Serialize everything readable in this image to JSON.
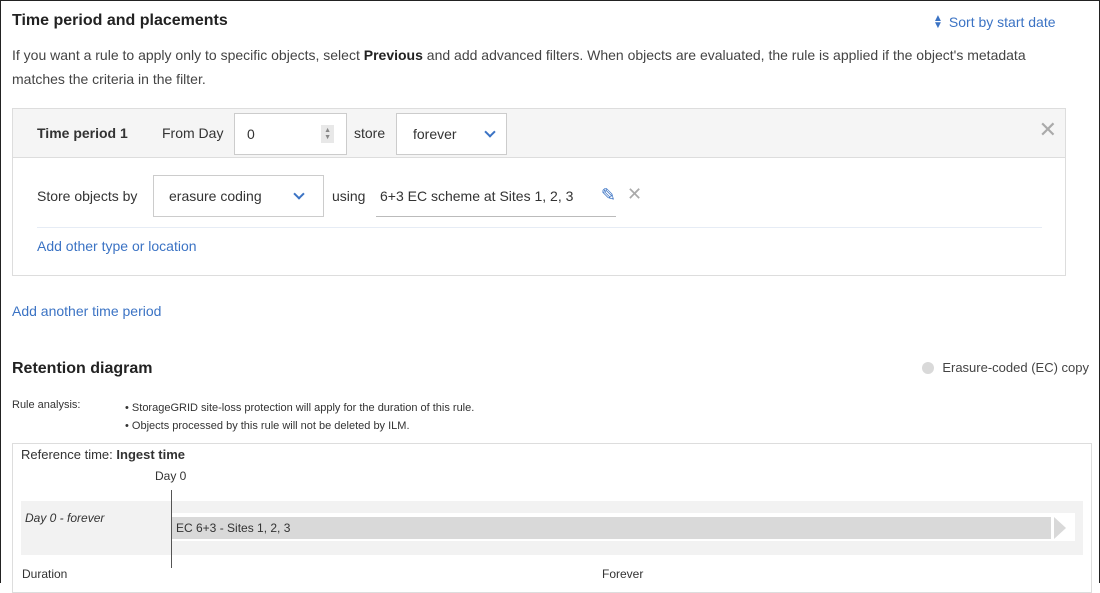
{
  "section": {
    "title": "Time period and placements",
    "sort_label": "Sort by start date",
    "desc_pre": "If you want a rule to apply only to specific objects, select ",
    "desc_bold": "Previous",
    "desc_post": " and add advanced filters. When objects are evaluated, the rule is applied if the object's metadata matches the criteria in the filter."
  },
  "period": {
    "title": "Time period 1",
    "from_label": "From Day",
    "from_value": "0",
    "store_label": "store",
    "store_value": "forever",
    "store_by_label": "Store objects by",
    "store_by_value": "erasure coding",
    "using_label": "using",
    "scheme_value": "6+3 EC scheme at Sites 1, 2, 3",
    "add_other": "Add other type or location"
  },
  "add_period": "Add another time period",
  "diagram": {
    "title": "Retention diagram",
    "legend": "Erasure-coded (EC) copy",
    "legend_color": "#d9d9d9",
    "analysis_label": "Rule analysis:",
    "analysis": [
      "StorageGRID site-loss protection will apply for the duration of this rule.",
      "Objects processed by this rule will not be deleted by ILM."
    ],
    "ref_label": "Reference time:",
    "ref_value": "Ingest time",
    "day_marker": "Day 0",
    "row_label": "Day 0 - forever",
    "bar_label": "EC 6+3 - Sites 1, 2, 3",
    "duration_label": "Duration",
    "duration_value": "Forever"
  }
}
